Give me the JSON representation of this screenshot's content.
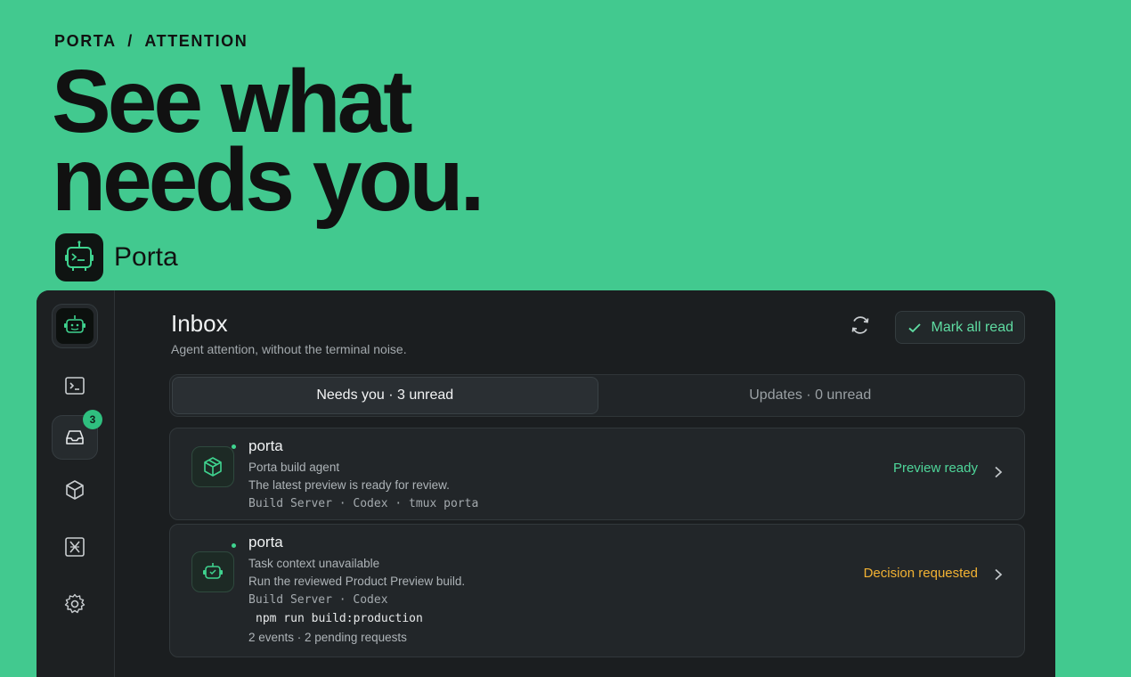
{
  "hero": {
    "eyebrow": "PORTA  /  ATTENTION",
    "headline_line1": "See what",
    "headline_line2": "needs you.",
    "brand_name": "Porta"
  },
  "sidebar": {
    "items": [
      {
        "icon": "app-logo-icon"
      },
      {
        "icon": "terminal-icon"
      },
      {
        "icon": "inbox-icon",
        "badge": "3"
      },
      {
        "icon": "cube-icon"
      },
      {
        "icon": "close-box-icon"
      },
      {
        "icon": "gear-icon"
      }
    ]
  },
  "inbox": {
    "title": "Inbox",
    "subtitle": "Agent attention, without the terminal noise.",
    "mark_all_label": "Mark all read",
    "tabs": [
      {
        "label": "Needs you · 3 unread",
        "active": true
      },
      {
        "label": "Updates · 0 unread",
        "active": false
      }
    ],
    "items": [
      {
        "title": "porta",
        "agent": "Porta build agent",
        "message": "The latest preview is ready for review.",
        "meta": "Build Server · Codex · tmux porta",
        "status": "Preview ready",
        "status_color": "#4fd69a",
        "icon": "package-icon"
      },
      {
        "title": "porta",
        "agent": "Task context unavailable",
        "message": "Run the reviewed Product Preview build.",
        "meta": "Build Server · Codex",
        "command": "npm run build:production",
        "footer": "2 events · 2 pending requests",
        "status": "Decision requested",
        "status_color": "#f2b233",
        "icon": "robot-icon"
      }
    ]
  },
  "colors": {
    "background": "#42c98f",
    "accent": "#4fd69a",
    "warning": "#f2b233"
  }
}
